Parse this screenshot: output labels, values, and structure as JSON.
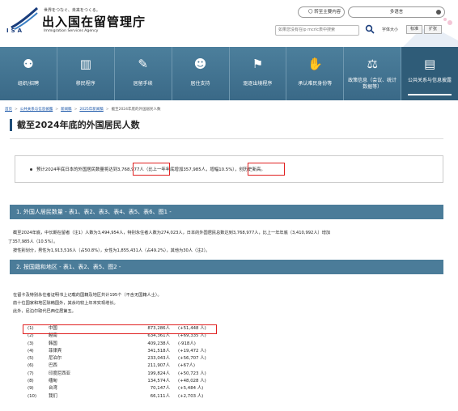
{
  "header": {
    "logo_abbr": "ISA",
    "tagline": "世界をつなぐ、未来をつくる。",
    "org_name": "出入国在留管理庁",
    "org_name_en": "Immigration Services Agency",
    "select_button": "〇 转至主要内容",
    "language_select": "多语言",
    "search_placeholder": "如果您没有在ip mcrlc表中搜索",
    "font_size_label": "字体大小",
    "font_standard": "标准",
    "font_large": "扩张"
  },
  "nav": {
    "items": [
      {
        "label": "组织/招聘",
        "icon": "people-icon"
      },
      {
        "label": "移民程序",
        "icon": "building-icon"
      },
      {
        "label": "居留手续",
        "icon": "document-pen-icon"
      },
      {
        "label": "居住支持",
        "icon": "person-support-icon"
      },
      {
        "label": "驱逐出境程序",
        "icon": "deportation-icon"
      },
      {
        "label": "承认难民身份等",
        "icon": "handshake-icon"
      },
      {
        "label": "政策信息（会议、统计数据等）",
        "icon": "gavel-icon"
      },
      {
        "label": "公共关系与信息披露",
        "icon": "notebook-icon"
      }
    ]
  },
  "breadcrumb": {
    "items": [
      "首页",
      "公共关系与信息披露",
      "新闻稿",
      "2025年新闻稿",
      "截至2024年底的外国居民人数"
    ]
  },
  "page_title": "截至2024年底的外国居民人数",
  "summary": {
    "text_before": "预计2024年底日本的外国居民数量将达到",
    "highlight_total": "3,768,977人",
    "text_middle": "（比上一年年底增加357,985人，",
    "highlight_rate": "增幅10.5%）",
    "text_after": "，创历史新高。"
  },
  "section1": {
    "heading": "1. 外国人居民数量 - 表1、表2、表3、表4、表5、表6、图1 -",
    "para1": "截至2024年底，中长期在留者（注1）人数为3,494,954人，特别永住者人数为274,023人，日本的外国居民总数达到3,768,977人，比上一年年底（3,410,992人）增加",
    "para2": "了357,985人（10.5%）。",
    "para3": "按性别划分，男性为1,913,516人（占50.8%），女性为1,855,431人（占49.2%），其他为30人（注2）。"
  },
  "section2": {
    "heading": "2. 按国籍和地区 - 表1、表2、表5、图2 -",
    "para1": "在留卡及特别永住者证明书上记载的国籍及地区共计195个（不含无国籍人士）。",
    "para2": "前十位国家和地区除韩国外，其余均较上年末实现增长。",
    "para3": "此外，尼泊尔取代巴西位居第五。"
  },
  "ranking": [
    {
      "rank": "(1)",
      "name": "中国",
      "count": "873,286人",
      "change": "(+51,448 人)"
    },
    {
      "rank": "(2)",
      "name": "越南",
      "count": "634,361人",
      "change": "(+69,335 人)"
    },
    {
      "rank": "(3)",
      "name": "韩国",
      "count": "409,238人",
      "change": "(-918人)"
    },
    {
      "rank": "(4)",
      "name": "菲律宾",
      "count": "341,518人",
      "change": "(+19,472 人)"
    },
    {
      "rank": "(5)",
      "name": "尼泊尔",
      "count": "233,043人",
      "change": "(+56,707 人)"
    },
    {
      "rank": "(6)",
      "name": "巴西",
      "count": "211,907人",
      "change": "(+67人)"
    },
    {
      "rank": "(7)",
      "name": "印度尼西亚",
      "count": "199,824人",
      "change": "(+50,723 人)"
    },
    {
      "rank": "(8)",
      "name": "缅甸",
      "count": "134,574人",
      "change": "(+48,028 人)"
    },
    {
      "rank": "(9)",
      "name": "台湾",
      "count": "70,147人",
      "change": "(+5,484 人)"
    },
    {
      "rank": "(10)",
      "name": "我们",
      "count": "66,111人",
      "change": "(+2,703 人)"
    }
  ],
  "colors": {
    "nav_bg": "#4c7f9c",
    "section_bg": "#4b7c99",
    "highlight_red": "#e02020",
    "title_bar": "#1f4e79"
  }
}
